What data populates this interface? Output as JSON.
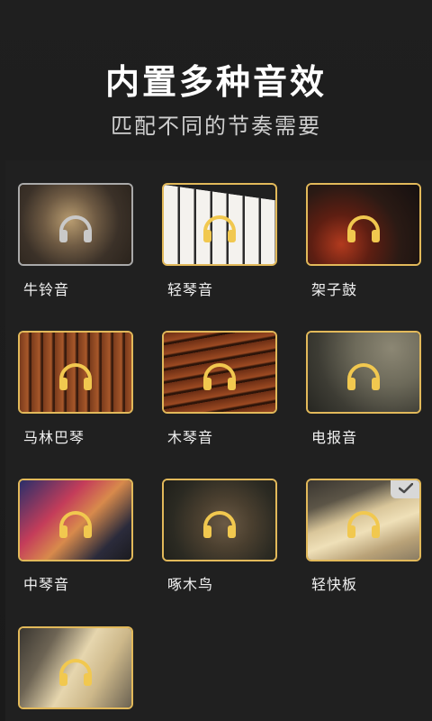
{
  "header": {
    "title": "内置多种音效",
    "subtitle": "匹配不同的节奏需要"
  },
  "sounds": [
    {
      "label": "牛铃音",
      "icon": "cowbell-image",
      "selected": true
    },
    {
      "label": "轻琴音",
      "icon": "piano-keys-image"
    },
    {
      "label": "架子鼓",
      "icon": "drum-kit-image"
    },
    {
      "label": "马林巴琴",
      "icon": "marimba-image"
    },
    {
      "label": "木琴音",
      "icon": "xylophone-image"
    },
    {
      "label": "电报音",
      "icon": "gauge-image"
    },
    {
      "label": "中琴音",
      "icon": "strings-image"
    },
    {
      "label": "啄木鸟",
      "icon": "bird-image"
    },
    {
      "label": "轻快板",
      "icon": "wooden-clapper-image",
      "checked": true
    },
    {
      "label": "",
      "icon": "clapper-image"
    }
  ],
  "colors": {
    "accent": "#e2b95a",
    "headphone": "#f1c84f",
    "background": "#1b1b1b"
  }
}
